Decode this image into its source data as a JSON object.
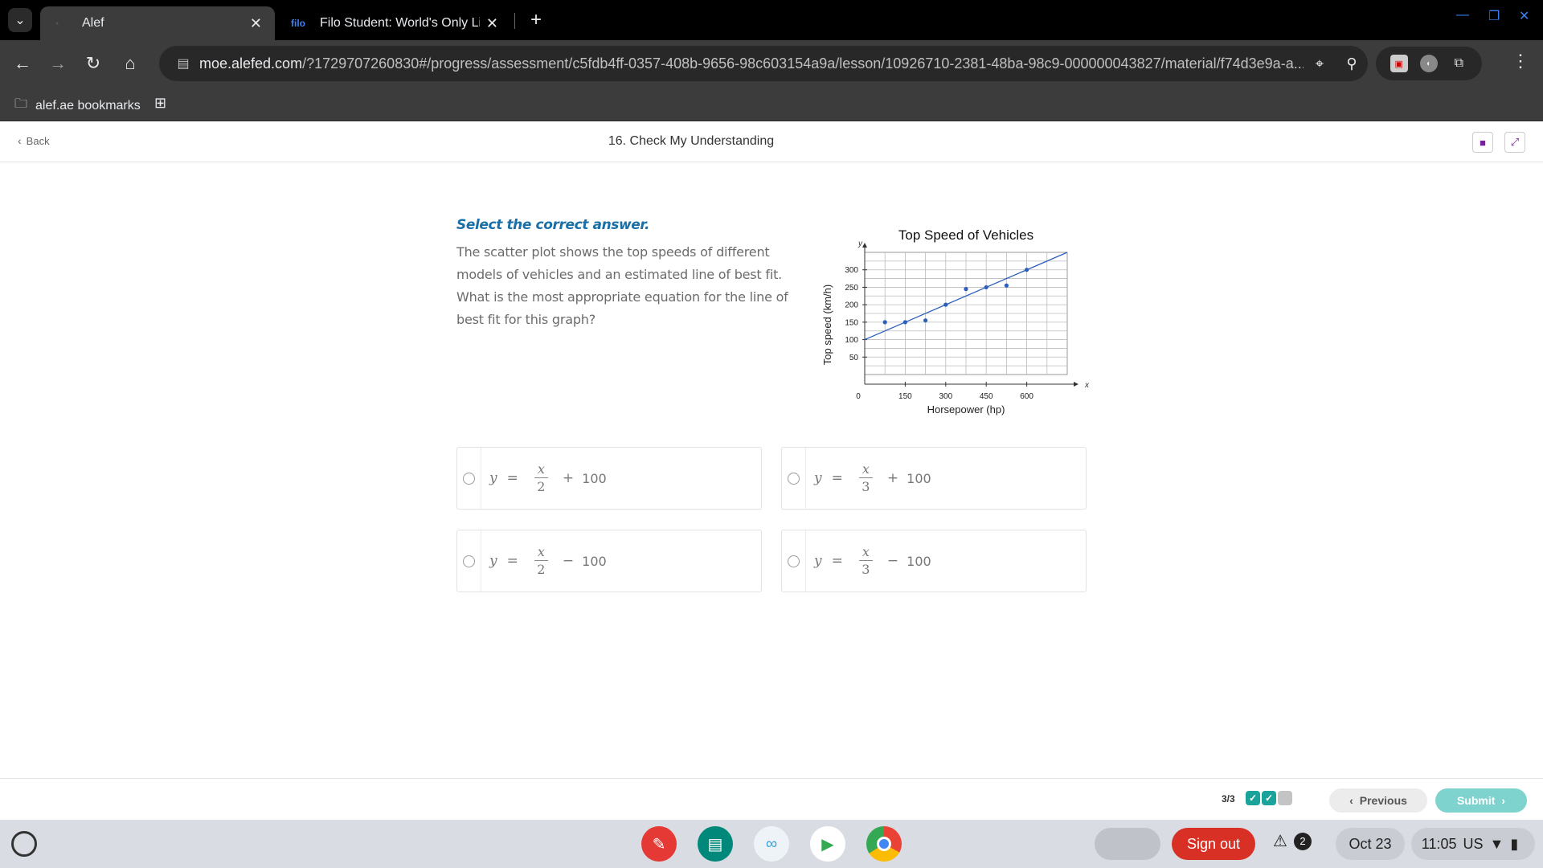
{
  "browser": {
    "tabs": [
      {
        "title": "Alef",
        "active": true
      },
      {
        "title": "Filo Student: World's Only Live I",
        "favicon_text": "filo",
        "active": false
      }
    ],
    "url_host": "moe.alefed.com",
    "url_path": "/?1729707260830#/progress/assessment/c5fdb4ff-0357-408b-9656-98c603154a9a/lesson/10926710-2381-48ba-98c9-000000043827/material/f74d3e9a-a...",
    "bookmark_folder": "alef.ae bookmarks"
  },
  "header": {
    "back_label": "Back",
    "page_title": "16. Check My Understanding"
  },
  "question": {
    "instruction": "Select the correct answer.",
    "text_1": "The scatter plot shows the top speeds of different models of vehicles and an estimated line of best fit.",
    "text_2": "What is the most appropriate equation for the line of best fit for this graph?"
  },
  "chart_data": {
    "type": "scatter",
    "title": "Top Speed of Vehicles",
    "xlabel": "Horsepower (hp)",
    "ylabel": "Top speed (km/h)",
    "x_axis_letter": "x",
    "y_axis_letter": "y",
    "origin_label": "0",
    "xlim": [
      0,
      750
    ],
    "ylim": [
      0,
      350
    ],
    "x_ticks": [
      150,
      300,
      450,
      600
    ],
    "y_ticks": [
      50,
      100,
      150,
      200,
      250,
      300
    ],
    "grid": true,
    "points": [
      {
        "x": 75,
        "y": 150
      },
      {
        "x": 150,
        "y": 150
      },
      {
        "x": 225,
        "y": 155
      },
      {
        "x": 300,
        "y": 200
      },
      {
        "x": 375,
        "y": 245
      },
      {
        "x": 450,
        "y": 250
      },
      {
        "x": 525,
        "y": 255
      },
      {
        "x": 600,
        "y": 300
      }
    ],
    "best_fit_line": {
      "slope": 0.3333,
      "intercept": 100
    },
    "colors": {
      "points": "#2c5fbd",
      "line": "#2c5fbd",
      "grid": "#bbbbbb"
    }
  },
  "options": [
    {
      "var": "y",
      "eq": "=",
      "num": "x",
      "den": "2",
      "op": "+",
      "const": "100"
    },
    {
      "var": "y",
      "eq": "=",
      "num": "x",
      "den": "3",
      "op": "+",
      "const": "100"
    },
    {
      "var": "y",
      "eq": "=",
      "num": "x",
      "den": "2",
      "op": "−",
      "const": "100"
    },
    {
      "var": "y",
      "eq": "=",
      "num": "x",
      "den": "3",
      "op": "−",
      "const": "100"
    }
  ],
  "footer": {
    "progress": "3/3",
    "previous_label": "Previous",
    "submit_label": "Submit"
  },
  "shelf": {
    "signout_label": "Sign out",
    "notification_count": "2",
    "date": "Oct 23",
    "time": "11:05",
    "locale": "US"
  },
  "colors": {
    "accent": "#1a6fa6",
    "progress_done": "#1aa39a",
    "submit": "#7fd3cf",
    "signout": "#d93025"
  }
}
